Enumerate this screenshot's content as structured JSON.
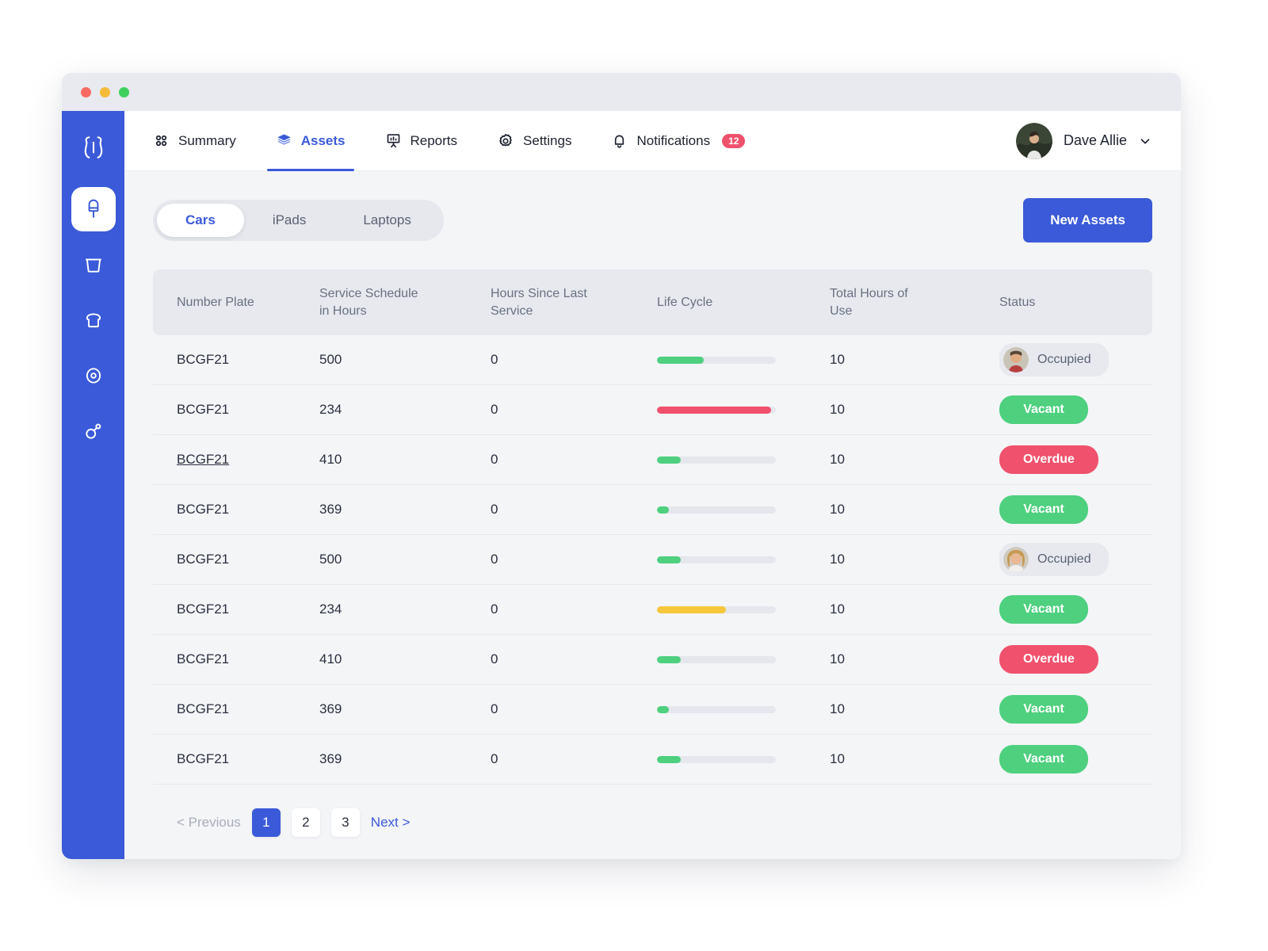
{
  "window": {
    "traffic_lights": [
      "close",
      "minimize",
      "maximize"
    ]
  },
  "sidebar": {
    "logo_icon": "bone-logo-icon",
    "items": [
      {
        "icon": "popsicle-icon",
        "active": true
      },
      {
        "icon": "bucket-icon",
        "active": false
      },
      {
        "icon": "bread-slice-icon",
        "active": false
      },
      {
        "icon": "fried-egg-icon",
        "active": false
      },
      {
        "icon": "drumstick-icon",
        "active": false
      }
    ]
  },
  "topnav": {
    "links": [
      {
        "label": "Summary",
        "icon": "grid-dots-icon",
        "active": false
      },
      {
        "label": "Assets",
        "icon": "layers-icon",
        "active": true
      },
      {
        "label": "Reports",
        "icon": "presentation-chart-icon",
        "active": false
      },
      {
        "label": "Settings",
        "icon": "gear-icon",
        "active": false
      },
      {
        "label": "Notifications",
        "icon": "bell-icon",
        "active": false,
        "badge": "12"
      }
    ],
    "profile": {
      "name": "Dave Allie",
      "avatar_icon": "user-avatar",
      "chevron_icon": "chevron-down-icon"
    }
  },
  "toolbar": {
    "segments": [
      {
        "label": "Cars",
        "active": true
      },
      {
        "label": "iPads",
        "active": false
      },
      {
        "label": "Laptops",
        "active": false
      }
    ],
    "new_assets_label": "New Assets"
  },
  "table": {
    "columns": [
      "Number Plate",
      "Service Schedule in Hours",
      "Hours Since Last Service",
      "Life Cycle",
      "Total Hours of Use",
      "Status"
    ],
    "rows": [
      {
        "plate": "BCGF21",
        "plate_link": false,
        "schedule": "500",
        "since_service": "0",
        "life_cycle_pct": 39,
        "life_cycle_color": "#4ed07e",
        "total_hours": "10",
        "status": "Occupied",
        "status_type": "occupied",
        "avatar": "male-avatar"
      },
      {
        "plate": "BCGF21",
        "plate_link": false,
        "schedule": "234",
        "since_service": "0",
        "life_cycle_pct": 96,
        "life_cycle_color": "#f0516d",
        "total_hours": "10",
        "status": "Vacant",
        "status_type": "vacant",
        "avatar": null
      },
      {
        "plate": "BCGF21",
        "plate_link": true,
        "schedule": "410",
        "since_service": "0",
        "life_cycle_pct": 20,
        "life_cycle_color": "#4ed07e",
        "total_hours": "10",
        "status": "Overdue",
        "status_type": "overdue",
        "avatar": null
      },
      {
        "plate": "BCGF21",
        "plate_link": false,
        "schedule": "369",
        "since_service": "0",
        "life_cycle_pct": 10,
        "life_cycle_color": "#4ed07e",
        "total_hours": "10",
        "status": "Vacant",
        "status_type": "vacant",
        "avatar": null
      },
      {
        "plate": "BCGF21",
        "plate_link": false,
        "schedule": "500",
        "since_service": "0",
        "life_cycle_pct": 20,
        "life_cycle_color": "#4ed07e",
        "total_hours": "10",
        "status": "Occupied",
        "status_type": "occupied",
        "avatar": "female-avatar"
      },
      {
        "plate": "BCGF21",
        "plate_link": false,
        "schedule": "234",
        "since_service": "0",
        "life_cycle_pct": 58,
        "life_cycle_color": "#f5c73c",
        "total_hours": "10",
        "status": "Vacant",
        "status_type": "vacant",
        "avatar": null
      },
      {
        "plate": "BCGF21",
        "plate_link": false,
        "schedule": "410",
        "since_service": "0",
        "life_cycle_pct": 20,
        "life_cycle_color": "#4ed07e",
        "total_hours": "10",
        "status": "Overdue",
        "status_type": "overdue",
        "avatar": null
      },
      {
        "plate": "BCGF21",
        "plate_link": false,
        "schedule": "369",
        "since_service": "0",
        "life_cycle_pct": 10,
        "life_cycle_color": "#4ed07e",
        "total_hours": "10",
        "status": "Vacant",
        "status_type": "vacant",
        "avatar": null
      },
      {
        "plate": "BCGF21",
        "plate_link": false,
        "schedule": "369",
        "since_service": "0",
        "life_cycle_pct": 20,
        "life_cycle_color": "#4ed07e",
        "total_hours": "10",
        "status": "Vacant",
        "status_type": "vacant",
        "avatar": null
      }
    ]
  },
  "pagination": {
    "previous_label": "< Previous",
    "pages": [
      "1",
      "2",
      "3"
    ],
    "active_page": "1",
    "next_label": "Next >"
  },
  "colors": {
    "brand_blue": "#3a5ad9",
    "green": "#4ed07e",
    "red": "#f0516d",
    "yellow": "#f5c73c",
    "page_bg": "#f4f5f7",
    "header_bg": "#e7e9ee"
  }
}
